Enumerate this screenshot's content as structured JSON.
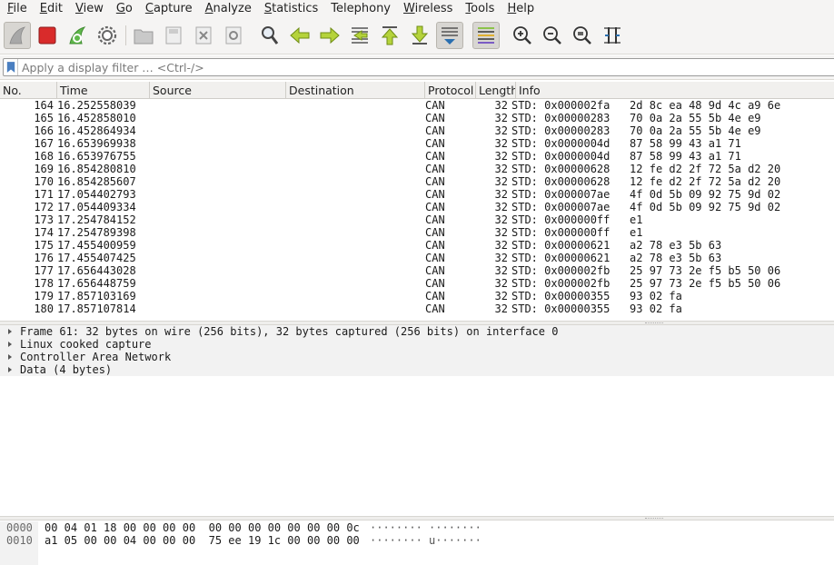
{
  "menubar": {
    "items": [
      {
        "accel": "F",
        "rest": "ile"
      },
      {
        "accel": "E",
        "rest": "dit"
      },
      {
        "accel": "V",
        "rest": "iew"
      },
      {
        "accel": "G",
        "rest": "o"
      },
      {
        "accel": "C",
        "rest": "apture"
      },
      {
        "accel": "A",
        "rest": "nalyze"
      },
      {
        "accel": "S",
        "rest": "tatistics"
      },
      {
        "accel": "",
        "rest": "Telephony"
      },
      {
        "accel": "W",
        "rest": "ireless"
      },
      {
        "accel": "T",
        "rest": "ools"
      },
      {
        "accel": "H",
        "rest": "elp"
      }
    ]
  },
  "toolbar": {
    "icons": [
      "shark-fin-start-icon",
      "stop-capture-icon",
      "restart-capture-icon",
      "capture-options-gear-icon",
      "open-file-icon",
      "save-file-icon",
      "close-file-icon",
      "reload-file-icon",
      "find-packet-icon",
      "go-back-icon",
      "go-forward-icon",
      "go-to-packet-icon",
      "first-packet-icon",
      "last-packet-icon",
      "autoscroll-icon",
      "colorize-icon",
      "zoom-in-icon",
      "zoom-out-icon",
      "normal-size-icon",
      "resize-columns-icon"
    ]
  },
  "filter": {
    "placeholder": "Apply a display filter … <Ctrl-/>"
  },
  "packet_list": {
    "columns": [
      "No.",
      "Time",
      "Source",
      "Destination",
      "Protocol",
      "Length",
      "Info"
    ],
    "rows": [
      {
        "no": "164",
        "time": "16.252558039",
        "src": "",
        "dst": "",
        "proto": "CAN",
        "len": "32",
        "info": "STD: 0x000002fa   2d 8c ea 48 9d 4c a9 6e"
      },
      {
        "no": "165",
        "time": "16.452858010",
        "src": "",
        "dst": "",
        "proto": "CAN",
        "len": "32",
        "info": "STD: 0x00000283   70 0a 2a 55 5b 4e e9"
      },
      {
        "no": "166",
        "time": "16.452864934",
        "src": "",
        "dst": "",
        "proto": "CAN",
        "len": "32",
        "info": "STD: 0x00000283   70 0a 2a 55 5b 4e e9"
      },
      {
        "no": "167",
        "time": "16.653969938",
        "src": "",
        "dst": "",
        "proto": "CAN",
        "len": "32",
        "info": "STD: 0x0000004d   87 58 99 43 a1 71"
      },
      {
        "no": "168",
        "time": "16.653976755",
        "src": "",
        "dst": "",
        "proto": "CAN",
        "len": "32",
        "info": "STD: 0x0000004d   87 58 99 43 a1 71"
      },
      {
        "no": "169",
        "time": "16.854280810",
        "src": "",
        "dst": "",
        "proto": "CAN",
        "len": "32",
        "info": "STD: 0x00000628   12 fe d2 2f 72 5a d2 20"
      },
      {
        "no": "170",
        "time": "16.854285607",
        "src": "",
        "dst": "",
        "proto": "CAN",
        "len": "32",
        "info": "STD: 0x00000628   12 fe d2 2f 72 5a d2 20"
      },
      {
        "no": "171",
        "time": "17.054402793",
        "src": "",
        "dst": "",
        "proto": "CAN",
        "len": "32",
        "info": "STD: 0x000007ae   4f 0d 5b 09 92 75 9d 02"
      },
      {
        "no": "172",
        "time": "17.054409334",
        "src": "",
        "dst": "",
        "proto": "CAN",
        "len": "32",
        "info": "STD: 0x000007ae   4f 0d 5b 09 92 75 9d 02"
      },
      {
        "no": "173",
        "time": "17.254784152",
        "src": "",
        "dst": "",
        "proto": "CAN",
        "len": "32",
        "info": "STD: 0x000000ff   e1"
      },
      {
        "no": "174",
        "time": "17.254789398",
        "src": "",
        "dst": "",
        "proto": "CAN",
        "len": "32",
        "info": "STD: 0x000000ff   e1"
      },
      {
        "no": "175",
        "time": "17.455400959",
        "src": "",
        "dst": "",
        "proto": "CAN",
        "len": "32",
        "info": "STD: 0x00000621   a2 78 e3 5b 63"
      },
      {
        "no": "176",
        "time": "17.455407425",
        "src": "",
        "dst": "",
        "proto": "CAN",
        "len": "32",
        "info": "STD: 0x00000621   a2 78 e3 5b 63"
      },
      {
        "no": "177",
        "time": "17.656443028",
        "src": "",
        "dst": "",
        "proto": "CAN",
        "len": "32",
        "info": "STD: 0x000002fb   25 97 73 2e f5 b5 50 06"
      },
      {
        "no": "178",
        "time": "17.656448759",
        "src": "",
        "dst": "",
        "proto": "CAN",
        "len": "32",
        "info": "STD: 0x000002fb   25 97 73 2e f5 b5 50 06"
      },
      {
        "no": "179",
        "time": "17.857103169",
        "src": "",
        "dst": "",
        "proto": "CAN",
        "len": "32",
        "info": "STD: 0x00000355   93 02 fa"
      },
      {
        "no": "180",
        "time": "17.857107814",
        "src": "",
        "dst": "",
        "proto": "CAN",
        "len": "32",
        "info": "STD: 0x00000355   93 02 fa"
      }
    ]
  },
  "details": {
    "items": [
      "Frame 61: 32 bytes on wire (256 bits), 32 bytes captured (256 bits) on interface 0",
      "Linux cooked capture",
      "Controller Area Network",
      "Data (4 bytes)"
    ]
  },
  "bytes": {
    "rows": [
      {
        "offset": "0000",
        "hex": "00 04 01 18 00 00 00 00  00 00 00 00 00 00 00 0c",
        "ascii": "········ ········"
      },
      {
        "offset": "0010",
        "hex": "a1 05 00 00 04 00 00 00  75 ee 19 1c 00 00 00 00",
        "ascii": "········ u·······"
      }
    ]
  }
}
